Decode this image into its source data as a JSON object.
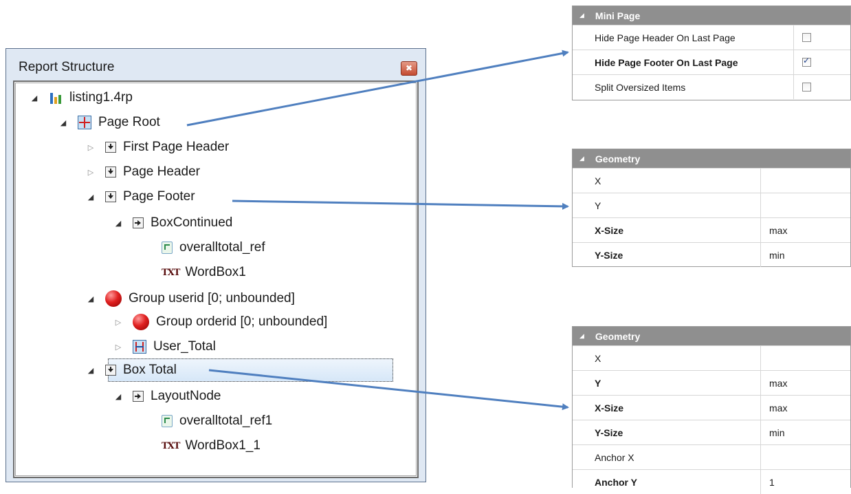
{
  "window": {
    "title": "Report Structure",
    "close_glyph": "✖"
  },
  "tree": {
    "nodes": [
      {
        "label": "listing1.4rp",
        "icon": "report-file-icon",
        "expander": "expanded"
      },
      {
        "label": "Page Root",
        "icon": "page-root-icon",
        "expander": "expanded"
      },
      {
        "label": "First Page Header",
        "icon": "band-icon",
        "expander": "collapsed"
      },
      {
        "label": "Page Header",
        "icon": "band-icon",
        "expander": "collapsed"
      },
      {
        "label": "Page Footer",
        "icon": "band-icon",
        "expander": "expanded"
      },
      {
        "label": "BoxContinued",
        "icon": "box-icon",
        "expander": "expanded"
      },
      {
        "label": "overalltotal_ref",
        "icon": "reference-icon",
        "expander": "none"
      },
      {
        "label": "WordBox1",
        "icon": "text-icon",
        "expander": "none"
      },
      {
        "label": "Group userid [0; unbounded]",
        "icon": "group-icon",
        "expander": "expanded"
      },
      {
        "label": "Group orderid [0; unbounded]",
        "icon": "group-icon",
        "expander": "collapsed"
      },
      {
        "label": "User_Total",
        "icon": "total-icon",
        "expander": "collapsed"
      },
      {
        "label": "Box Total",
        "icon": "band-icon",
        "expander": "expanded",
        "selected": true
      },
      {
        "label": "LayoutNode",
        "icon": "box-icon",
        "expander": "expanded"
      },
      {
        "label": "overalltotal_ref1",
        "icon": "reference-icon",
        "expander": "none"
      },
      {
        "label": "WordBox1_1",
        "icon": "text-icon",
        "expander": "none"
      }
    ],
    "txt_glyph": "TXT"
  },
  "panels": {
    "mini_page": {
      "header": "Mini Page",
      "rows": [
        {
          "key": "Hide Page Header On Last Page",
          "checked": false,
          "bold": false
        },
        {
          "key": "Hide Page Footer On Last Page",
          "checked": true,
          "bold": true
        },
        {
          "key": "Split Oversized Items",
          "checked": false,
          "bold": false
        }
      ]
    },
    "geometry_1": {
      "header": "Geometry",
      "rows": [
        {
          "key": "X",
          "value": "",
          "bold": false
        },
        {
          "key": "Y",
          "value": "",
          "bold": false
        },
        {
          "key": "X-Size",
          "value": "max",
          "bold": true
        },
        {
          "key": "Y-Size",
          "value": "min",
          "bold": true
        }
      ]
    },
    "geometry_2": {
      "header": "Geometry",
      "rows": [
        {
          "key": "X",
          "value": "",
          "bold": false
        },
        {
          "key": "Y",
          "value": "max",
          "bold": true
        },
        {
          "key": "X-Size",
          "value": "max",
          "bold": true
        },
        {
          "key": "Y-Size",
          "value": "min",
          "bold": true
        },
        {
          "key": "Anchor X",
          "value": "",
          "bold": false
        },
        {
          "key": "Anchor Y",
          "value": "1",
          "bold": true
        }
      ]
    }
  },
  "colors": {
    "arrow": "#4f7fbf",
    "panel_header": "#8f8f8f",
    "window_frame": "#dfe8f3"
  }
}
